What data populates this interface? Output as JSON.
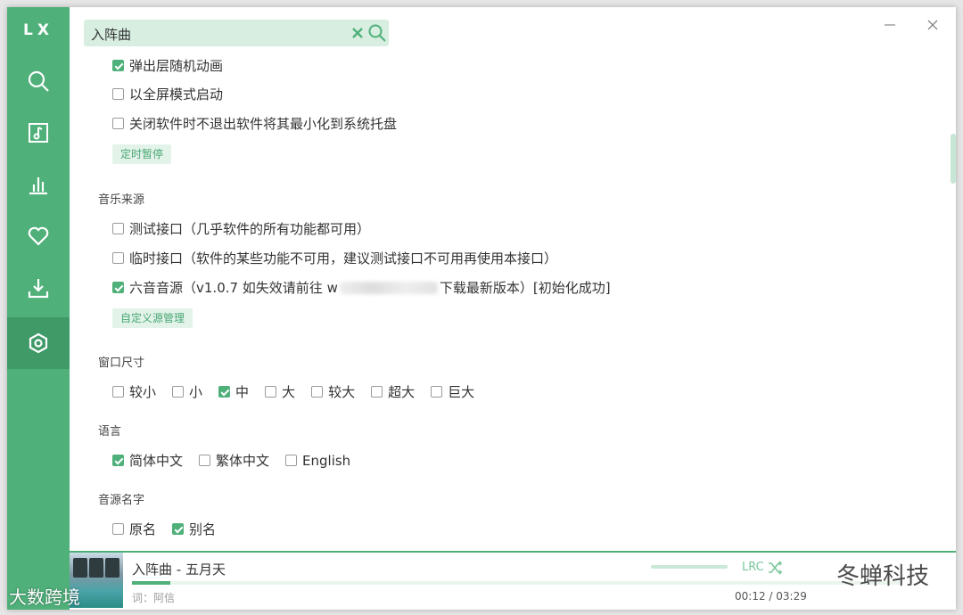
{
  "sidebar": {
    "logo": "LX",
    "items": [
      {
        "name": "search",
        "icon": "search-icon"
      },
      {
        "name": "song-list",
        "icon": "music-note-icon"
      },
      {
        "name": "leaderboard",
        "icon": "bar-chart-icon"
      },
      {
        "name": "my-list",
        "icon": "heart-icon"
      },
      {
        "name": "download",
        "icon": "download-icon"
      },
      {
        "name": "settings",
        "icon": "settings-icon",
        "active": true
      }
    ]
  },
  "search": {
    "value": "入阵曲",
    "clear_icon": "close-icon",
    "search_icon": "search-icon"
  },
  "window": {
    "minimize_icon": "minimize-icon",
    "close_icon": "close-icon"
  },
  "settings": {
    "general": [
      {
        "label": "弹出层随机动画",
        "checked": true
      },
      {
        "label": "以全屏模式启动",
        "checked": false
      },
      {
        "label": "关闭软件时不退出软件将其最小化到系统托盘",
        "checked": false
      }
    ],
    "timer_button": "定时暂停",
    "music_source": {
      "title": "音乐来源",
      "options": [
        {
          "label": "测试接口（几乎软件的所有功能都可用）",
          "checked": false
        },
        {
          "label": "临时接口（软件的某些功能不可用，建议测试接口不可用再使用本接口）",
          "checked": false
        },
        {
          "label_prefix": "六音音源（v1.0.7 如失效请前往 w",
          "label_suffix": "下载最新版本）[初始化成功]",
          "checked": true
        }
      ],
      "custom_button": "自定义源管理"
    },
    "window_size": {
      "title": "窗口尺寸",
      "options": [
        {
          "label": "较小",
          "checked": false
        },
        {
          "label": "小",
          "checked": false
        },
        {
          "label": "中",
          "checked": true
        },
        {
          "label": "大",
          "checked": false
        },
        {
          "label": "较大",
          "checked": false
        },
        {
          "label": "超大",
          "checked": false
        },
        {
          "label": "巨大",
          "checked": false
        }
      ]
    },
    "language": {
      "title": "语言",
      "options": [
        {
          "label": "简体中文",
          "checked": true
        },
        {
          "label": "繁体中文",
          "checked": false
        },
        {
          "label": "English",
          "checked": false
        }
      ]
    },
    "source_name": {
      "title": "音源名字",
      "options": [
        {
          "label": "原名",
          "checked": false
        },
        {
          "label": "别名",
          "checked": true
        }
      ]
    }
  },
  "player": {
    "title": "入阵曲 - 五月天",
    "lyric": "词：阿信",
    "time": "00:12 / 03:29",
    "progress": 0.05,
    "lrc_label": "LRC"
  },
  "watermarks": {
    "left": "大数跨境",
    "right": "冬蝉科技"
  },
  "colors": {
    "accent": "#4fb07a",
    "accent_dark": "#3f9a68",
    "accent_light": "#d7eee1"
  }
}
